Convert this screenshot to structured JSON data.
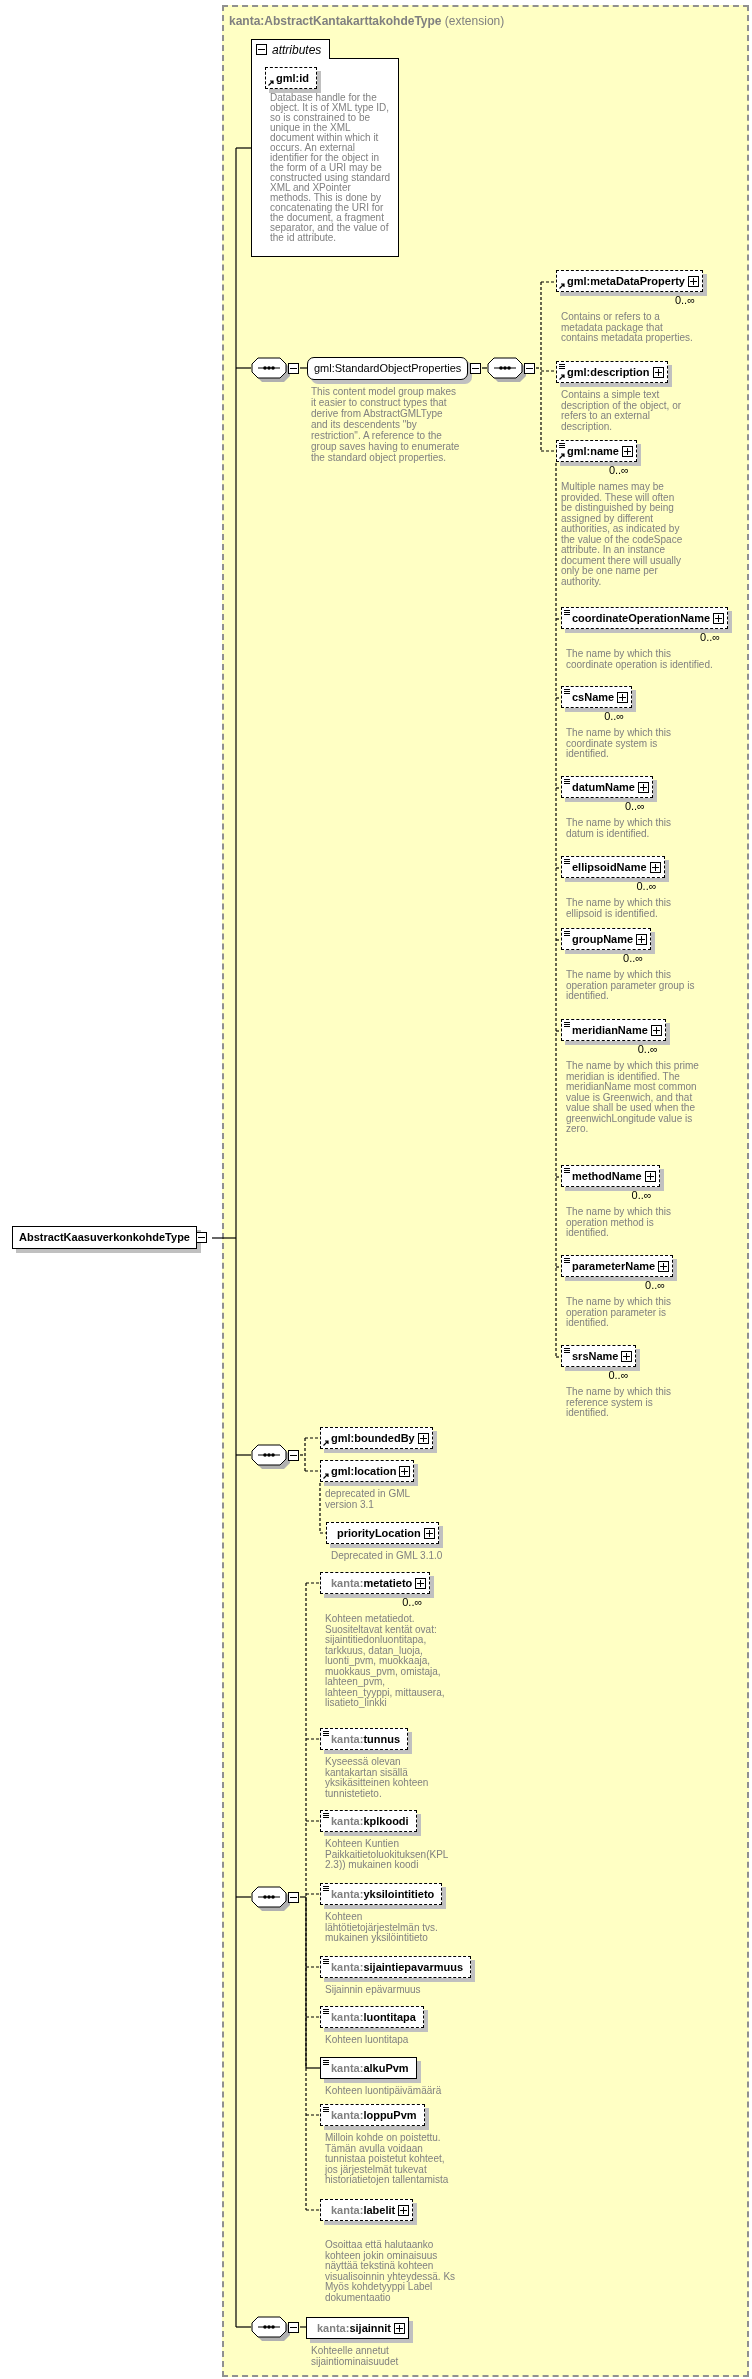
{
  "root": {
    "name": "AbstractKaasuverkonkohdeType",
    "expanded": true
  },
  "base": {
    "prefix": "kanta:",
    "name": "AbstractKantakarttakohdeType",
    "derivation": "(extension)"
  },
  "attributes": {
    "label": "attributes",
    "expanded": true,
    "items": [
      {
        "name": "gml:id",
        "optional": true,
        "reference": true,
        "simple": false,
        "expandable": false,
        "doc": "Database handle for the object. It is of XML type ID, so is constrained to be unique in the XML document within which it occurs. An external identifier for the object in the form of a URI may be constructed using standard XML and XPointer methods. This is done by concatenating the URI for the document, a fragment separator, and the value of the id attribute."
      }
    ]
  },
  "content": [
    {
      "kind": "sequence",
      "expanded": true,
      "children": [
        {
          "kind": "group",
          "name": "gml:StandardObjectProperties",
          "expanded": true,
          "doc": "This content model group makes it easier to construct types that derive from AbstractGMLType and its descendents \"by restriction\". A reference to the group saves having to enumerate the standard object properties.",
          "children": [
            {
              "kind": "sequence",
              "expanded": true,
              "children": [
                {
                  "kind": "element",
                  "name": "gml:metaDataProperty",
                  "optional": true,
                  "reference": true,
                  "simple": false,
                  "expandable": true,
                  "occurs": "0..∞",
                  "doc": "Contains or refers to a metadata package that contains metadata properties."
                },
                {
                  "kind": "element",
                  "name": "gml:description",
                  "optional": true,
                  "reference": true,
                  "simple": true,
                  "expandable": true,
                  "doc": "Contains a simple text description of the object, or refers to an external description."
                },
                {
                  "kind": "element",
                  "name": "gml:name",
                  "optional": true,
                  "reference": true,
                  "simple": true,
                  "expandable": true,
                  "occurs": "0..∞",
                  "doc": "Multiple names may be provided. These will often be distinguished by being assigned by different authorities, as indicated by the value of the codeSpace attribute. In an instance document there will usually only be one name per authority.",
                  "substitutes": [
                    {
                      "kind": "element",
                      "name": "coordinateOperationName",
                      "optional": true,
                      "reference": false,
                      "simple": true,
                      "expandable": true,
                      "occurs": "0..∞",
                      "doc": "The name by which this coordinate operation is identified."
                    },
                    {
                      "kind": "element",
                      "name": "csName",
                      "optional": true,
                      "reference": false,
                      "simple": true,
                      "expandable": true,
                      "occurs": "0..∞",
                      "doc": "The name by which this coordinate system is identified."
                    },
                    {
                      "kind": "element",
                      "name": "datumName",
                      "optional": true,
                      "reference": false,
                      "simple": true,
                      "expandable": true,
                      "occurs": "0..∞",
                      "doc": "The name by which this datum is identified."
                    },
                    {
                      "kind": "element",
                      "name": "ellipsoidName",
                      "optional": true,
                      "reference": false,
                      "simple": true,
                      "expandable": true,
                      "occurs": "0..∞",
                      "doc": "The name by which this ellipsoid is identified."
                    },
                    {
                      "kind": "element",
                      "name": "groupName",
                      "optional": true,
                      "reference": false,
                      "simple": true,
                      "expandable": true,
                      "occurs": "0..∞",
                      "doc": "The name by which this operation parameter group is identified."
                    },
                    {
                      "kind": "element",
                      "name": "meridianName",
                      "optional": true,
                      "reference": false,
                      "simple": true,
                      "expandable": true,
                      "occurs": "0..∞",
                      "doc": "The name by which this prime meridian is identified. The meridianName most common value is Greenwich, and that value shall be used when the greenwichLongitude value is zero."
                    },
                    {
                      "kind": "element",
                      "name": "methodName",
                      "optional": true,
                      "reference": false,
                      "simple": true,
                      "expandable": true,
                      "occurs": "0..∞",
                      "doc": "The name by which this operation method is identified."
                    },
                    {
                      "kind": "element",
                      "name": "parameterName",
                      "optional": true,
                      "reference": false,
                      "simple": true,
                      "expandable": true,
                      "occurs": "0..∞",
                      "doc": "The name by which this operation parameter is identified."
                    },
                    {
                      "kind": "element",
                      "name": "srsName",
                      "optional": true,
                      "reference": false,
                      "simple": true,
                      "expandable": true,
                      "occurs": "0..∞",
                      "doc": "The name by which this reference system is identified."
                    }
                  ]
                }
              ]
            }
          ]
        }
      ]
    },
    {
      "kind": "sequence",
      "expanded": true,
      "children": [
        {
          "kind": "element",
          "name": "gml:boundedBy",
          "optional": true,
          "reference": true,
          "simple": false,
          "expandable": true
        },
        {
          "kind": "element",
          "name": "gml:location",
          "optional": true,
          "reference": true,
          "simple": false,
          "expandable": true,
          "doc": "deprecated in GML version 3.1",
          "substitutes": [
            {
              "kind": "element",
              "name": "priorityLocation",
              "optional": true,
              "reference": false,
              "simple": false,
              "expandable": true,
              "doc": "Deprecated in GML 3.1.0"
            }
          ]
        }
      ]
    },
    {
      "kind": "sequence",
      "expanded": true,
      "children": [
        {
          "kind": "element",
          "prefix": "kanta:",
          "name": "metatieto",
          "optional": true,
          "reference": false,
          "simple": false,
          "expandable": true,
          "occurs": "0..∞",
          "doc": "Kohteen metatiedot. Suositeltavat kentät ovat: sijaintitiedonluontitapa, tarkkuus, datan_luoja, luonti_pvm, muokkaaja, muokkaus_pvm, omistaja, lahteen_pvm, lahteen_tyyppi, mittausera, lisatieto_linkki"
        },
        {
          "kind": "element",
          "prefix": "kanta:",
          "name": "tunnus",
          "optional": true,
          "reference": false,
          "simple": true,
          "expandable": false,
          "doc": "Kyseessä olevan kantakartan sisällä yksikäsitteinen kohteen tunnistetieto."
        },
        {
          "kind": "element",
          "prefix": "kanta:",
          "name": "kplkoodi",
          "optional": true,
          "reference": false,
          "simple": true,
          "expandable": false,
          "doc": "Kohteen Kuntien Paikkaitietoluokituksen(KPL 2.3)) mukainen koodi"
        },
        {
          "kind": "element",
          "prefix": "kanta:",
          "name": "yksilointitieto",
          "optional": true,
          "reference": false,
          "simple": true,
          "expandable": false,
          "doc": "Kohteen lähtötietojärjestelmän tvs. mukainen yksilöintitieto"
        },
        {
          "kind": "element",
          "prefix": "kanta:",
          "name": "sijaintiepavarmuus",
          "optional": true,
          "reference": false,
          "simple": true,
          "expandable": false,
          "doc": "Sijainnin epävarmuus"
        },
        {
          "kind": "element",
          "prefix": "kanta:",
          "name": "luontitapa",
          "optional": true,
          "reference": false,
          "simple": true,
          "expandable": false,
          "doc": "Kohteen luontitapa"
        },
        {
          "kind": "element",
          "prefix": "kanta:",
          "name": "alkuPvm",
          "optional": false,
          "reference": false,
          "simple": true,
          "expandable": false,
          "doc": "Kohteen luontipäivämäärä"
        },
        {
          "kind": "element",
          "prefix": "kanta:",
          "name": "loppuPvm",
          "optional": true,
          "reference": false,
          "simple": true,
          "expandable": false,
          "doc": "Milloin kohde on poistettu. Tämän avulla voidaan tunnistaa poistetut kohteet, jos järjestelmät tukevat historiatietojen tallentamista"
        },
        {
          "kind": "element",
          "prefix": "kanta:",
          "name": "labelit",
          "optional": true,
          "reference": false,
          "simple": false,
          "expandable": true,
          "doc": "Osoittaa että halutaanko kohteen jokin ominaisuus näyttää tekstinä kohteen visualisoinnin yhteydessä. Ks Myös kohdetyyppi Label dokumentaatio"
        }
      ]
    },
    {
      "kind": "sequence",
      "expanded": true,
      "children": [
        {
          "kind": "element",
          "prefix": "kanta:",
          "name": "sijainnit",
          "optional": false,
          "reference": false,
          "simple": false,
          "expandable": true,
          "doc": "Kohteelle annetut sijaintiominaisuudet"
        }
      ]
    }
  ]
}
